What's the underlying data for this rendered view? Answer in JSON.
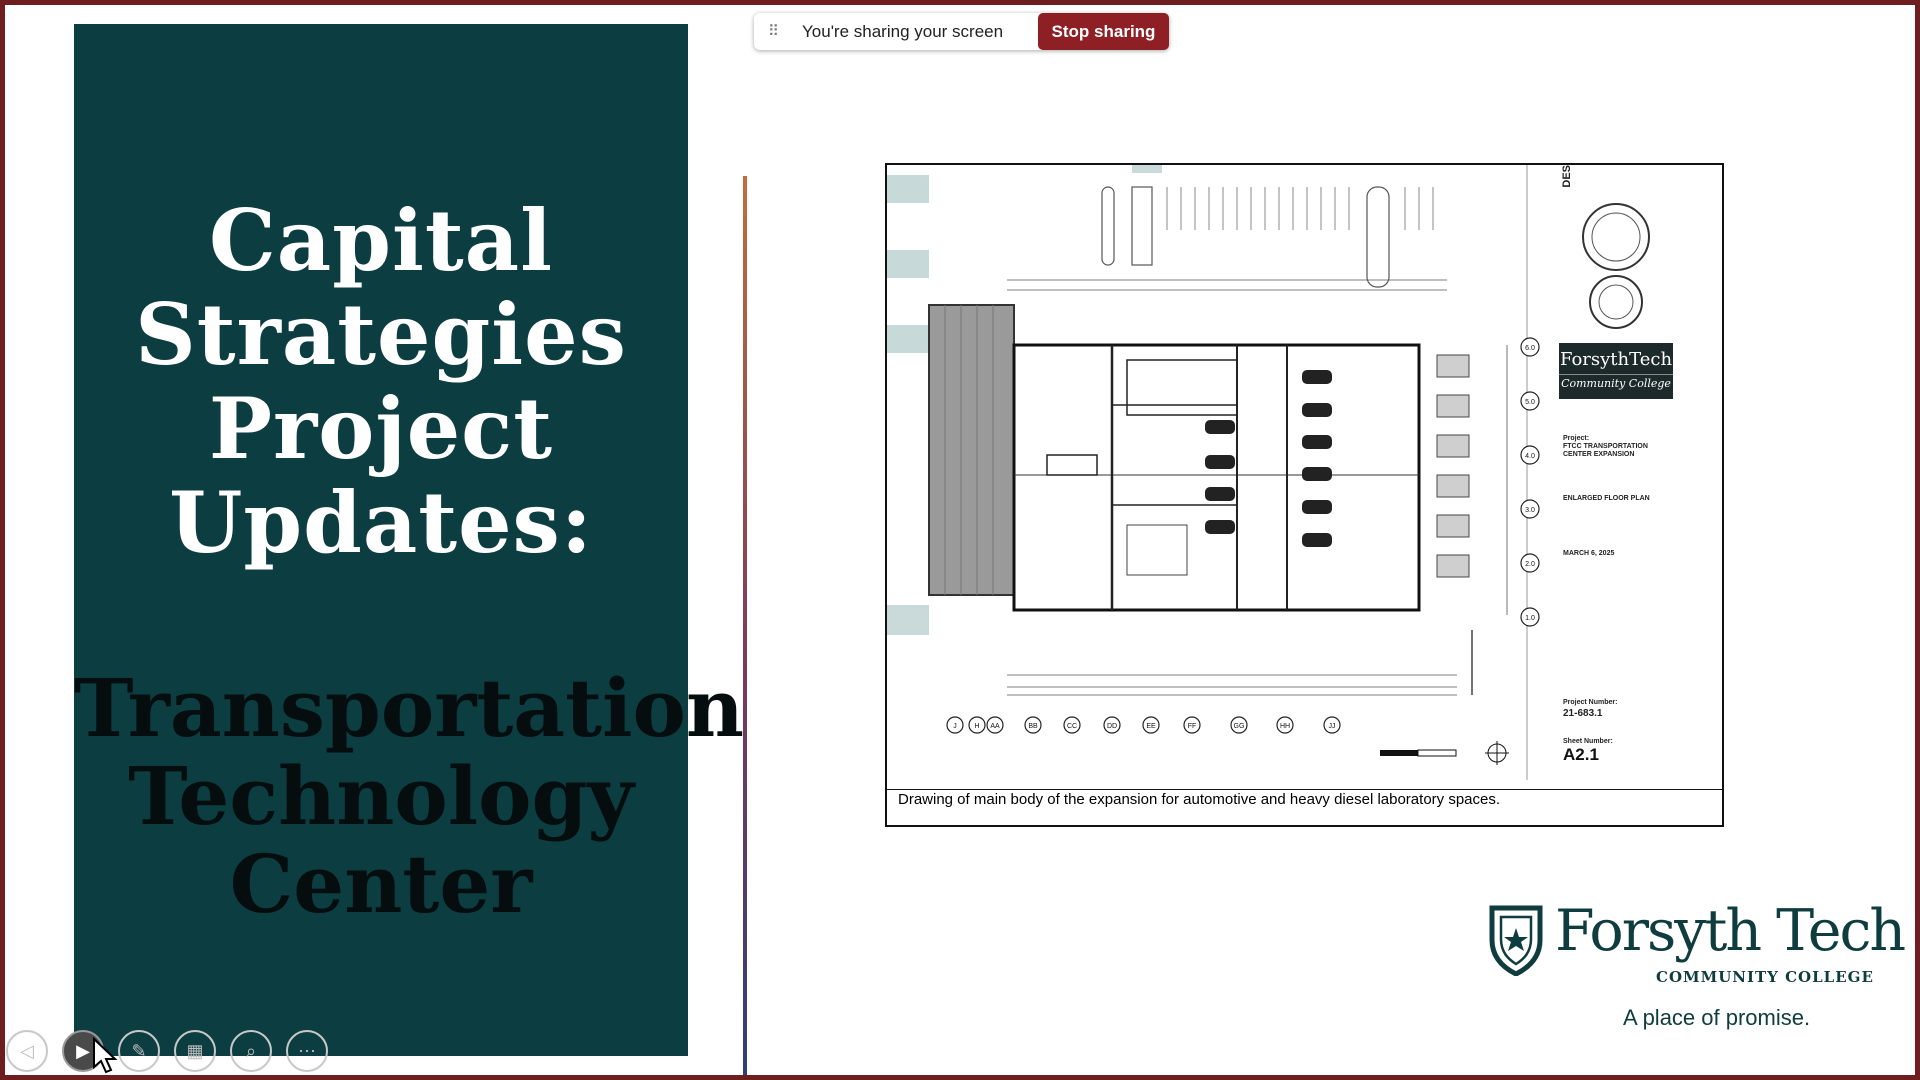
{
  "share_bar": {
    "message": "You're sharing your screen",
    "stop_label": "Stop sharing"
  },
  "slide": {
    "title_lines": [
      "Capital",
      "Strategies",
      "Project",
      "Updates:"
    ],
    "subtitle_lines": [
      "Transportation",
      "Technology",
      "Center"
    ],
    "figure": {
      "caption": "Drawing of main body of the expansion for automotive and heavy diesel laboratory spaces.",
      "title_block": {
        "logo_name": "ForsythTech",
        "logo_sub": "Community College",
        "project_label": "Project:",
        "project_value": "FTCC TRANSPORTATION CENTER EXPANSION",
        "sheet_title_value": "ENLARGED FLOOR PLAN",
        "issue_date_value": "MARCH 6, 2025",
        "project_number_label": "Project Number:",
        "project_number": "21-683.1",
        "sheet_number_label": "Sheet Number:",
        "sheet_number": "A2.1",
        "side_label": "DES"
      },
      "grid_bubbles_bottom": [
        "J",
        "H",
        "AA",
        "BB",
        "CC",
        "DD",
        "EE",
        "FF",
        "GG",
        "HH",
        "JJ"
      ],
      "grid_bubbles_right": [
        "6.0",
        "5.0",
        "4.0",
        "3.0",
        "2.0",
        "1.0"
      ]
    },
    "brand": {
      "name": "Forsyth Tech",
      "sub": "COMMUNITY COLLEGE",
      "tagline": "A place of promise."
    }
  },
  "slideshow_controls": [
    {
      "name": "previous-slide-button",
      "icon": "chevron-left-icon",
      "glyph": "◁"
    },
    {
      "name": "next-slide-button",
      "icon": "play-icon",
      "glyph": "▶"
    },
    {
      "name": "pen-tool-button",
      "icon": "pen-icon",
      "glyph": "✎"
    },
    {
      "name": "see-all-slides-button",
      "icon": "slides-grid-icon",
      "glyph": "▦"
    },
    {
      "name": "zoom-button",
      "icon": "magnifier-icon",
      "glyph": "⌕"
    },
    {
      "name": "more-options-button",
      "icon": "ellipsis-icon",
      "glyph": "⋯"
    }
  ],
  "colors": {
    "panel": "#0c3d41",
    "stop_button": "#8e1f24",
    "frame": "#6e1e20",
    "brand": "#0f3c3f"
  }
}
